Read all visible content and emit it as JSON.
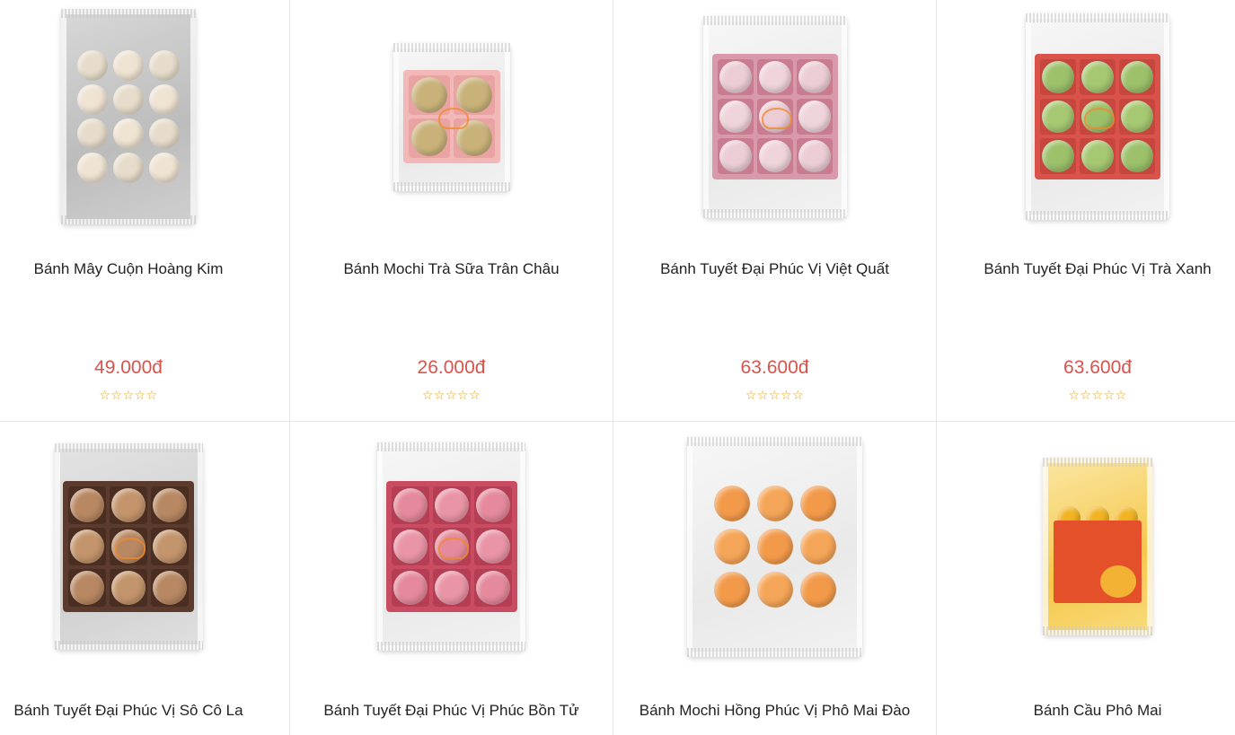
{
  "products": [
    {
      "name": "Bánh Mây Cuộn Hoàng Kim",
      "price": "49.000đ",
      "rating_stars": "☆☆☆☆☆",
      "rating": 0,
      "icon": "product-photo"
    },
    {
      "name": "Bánh Mochi Trà Sữa Trân Châu",
      "price": "26.000đ",
      "rating_stars": "☆☆☆☆☆",
      "rating": 0,
      "icon": "product-photo"
    },
    {
      "name": "Bánh Tuyết Đại Phúc Vị Việt Quất",
      "price": "63.600đ",
      "rating_stars": "☆☆☆☆☆",
      "rating": 0,
      "icon": "product-photo"
    },
    {
      "name": "Bánh Tuyết Đại Phúc Vị Trà Xanh",
      "price": "63.600đ",
      "rating_stars": "☆☆☆☆☆",
      "rating": 0,
      "icon": "product-photo"
    },
    {
      "name": "Bánh Tuyết Đại Phúc Vị Sô Cô La",
      "icon": "product-photo"
    },
    {
      "name": "Bánh Tuyết Đại Phúc Vị Phúc Bồn Tử",
      "icon": "product-photo"
    },
    {
      "name": "Bánh Mochi Hồng Phúc Vị Phô Mai Đào",
      "icon": "product-photo"
    },
    {
      "name": "Bánh Cầu Phô Mai",
      "icon": "product-photo"
    }
  ],
  "colors": {
    "price": "#d8534b",
    "star": "#e3a21a",
    "divider": "#e7e7e7"
  }
}
